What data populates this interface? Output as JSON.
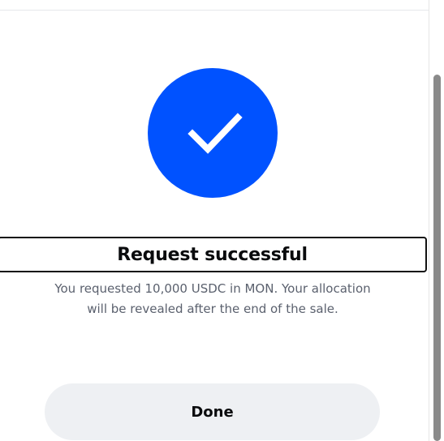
{
  "dialog": {
    "title": "Request successful",
    "description_line1": "You requested 10,000 USDC in MON. Your allocation",
    "description_line2": "will be revealed after the end of the sale.",
    "done_label": "Done",
    "success_icon": "checkmark-icon"
  },
  "colors": {
    "accent": "#0052ff",
    "button_background": "#eef0f3",
    "text_primary": "#0a0b0d",
    "text_secondary": "#5b616e"
  }
}
